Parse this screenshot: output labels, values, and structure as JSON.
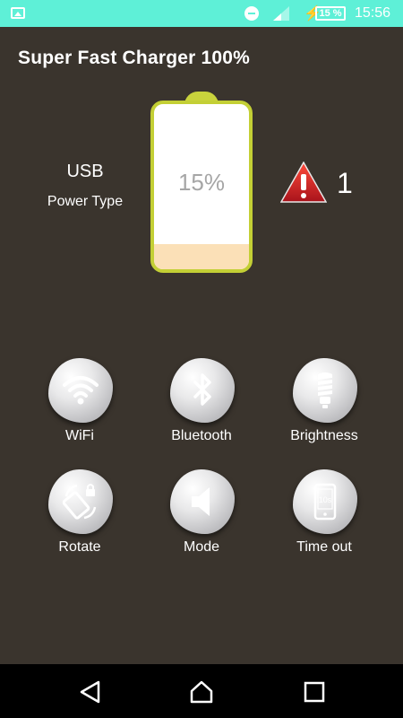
{
  "status_bar": {
    "battery_percent": "15 %",
    "time": "15:56"
  },
  "app": {
    "title": "Super Fast Charger 100%"
  },
  "charging": {
    "source": "USB",
    "source_label": "Power Type",
    "level_text": "15%",
    "level": 0.15,
    "warning_count": "1"
  },
  "controls": [
    {
      "id": "wifi",
      "label": "WiFi",
      "icon": "wifi-icon"
    },
    {
      "id": "bluetooth",
      "label": "Bluetooth",
      "icon": "bluetooth-icon"
    },
    {
      "id": "brightness",
      "label": "Brightness",
      "icon": "lightbulb-icon"
    },
    {
      "id": "rotate",
      "label": "Rotate",
      "icon": "rotate-lock-icon"
    },
    {
      "id": "mode",
      "label": "Mode",
      "icon": "speaker-icon"
    },
    {
      "id": "timeout",
      "label": "Time out",
      "icon": "timeout-icon",
      "icon_text": "10s"
    }
  ],
  "colors": {
    "status_bar": "#5ef0d7",
    "background": "#3a342d",
    "battery_frame": "#c3cf35",
    "battery_fill": "#fbe0b7",
    "warning": "#d4232a"
  }
}
